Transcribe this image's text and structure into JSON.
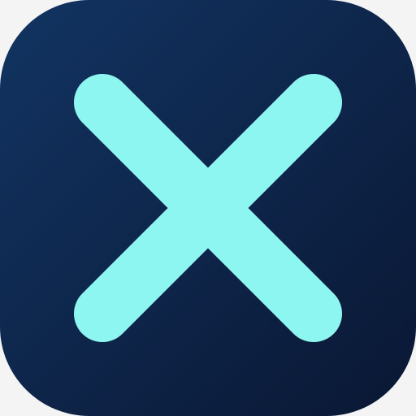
{
  "icon": {
    "name": "close-icon",
    "shape": "rounded-square-app-icon",
    "colors": {
      "background_top_left": "#123462",
      "background_bottom_right": "#0a1733",
      "glyph": "#8df6f0",
      "page": "#f4f4f4"
    }
  }
}
